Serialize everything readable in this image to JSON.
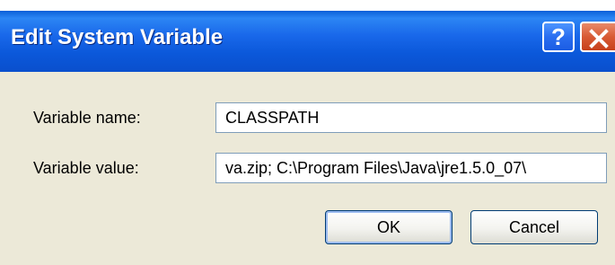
{
  "dialog": {
    "title": "Edit System Variable",
    "help_glyph": "?",
    "close_icon": "close-icon"
  },
  "fields": {
    "name_label": "Variable name:",
    "name_value": "CLASSPATH",
    "value_label": "Variable value:",
    "value_value": "va.zip; C:\\Program Files\\Java\\jre1.5.0_07\\"
  },
  "buttons": {
    "ok": "OK",
    "cancel": "Cancel"
  },
  "colors": {
    "titlebar": "#0b58da",
    "window_bg": "#ece9d8",
    "close_button": "#d85a34"
  }
}
